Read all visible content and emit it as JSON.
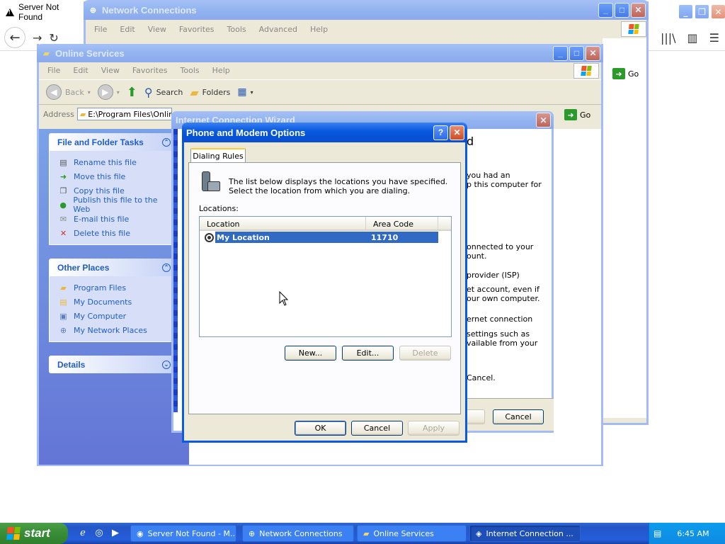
{
  "browser": {
    "tab_title": "Server Not Found",
    "back_glyph": "←",
    "forward_glyph": "→",
    "reload_glyph": "↻",
    "library_glyph": "|||\\",
    "sidebar_glyph": "▥",
    "menu_glyph": "☰",
    "min_glyph": "_",
    "restore_glyph": "❐",
    "close_glyph": "✕"
  },
  "net_window": {
    "title": "Network Connections",
    "menus": [
      "File",
      "Edit",
      "View",
      "Favorites",
      "Tools",
      "Advanced",
      "Help"
    ],
    "go_label": "Go"
  },
  "os_window": {
    "title": "Online Services",
    "menus": [
      "File",
      "Edit",
      "View",
      "Favorites",
      "Tools",
      "Help"
    ],
    "toolbar": {
      "back": "Back",
      "search": "Search",
      "folders": "Folders"
    },
    "address_label": "Address",
    "address_value": "E:\\Program Files\\Online Services",
    "go_label": "Go",
    "file_tasks": {
      "heading": "File and Folder Tasks",
      "items": [
        "Rename this file",
        "Move this file",
        "Copy this file",
        "Publish this file to the Web",
        "E-mail this file",
        "Delete this file"
      ]
    },
    "other_places": {
      "heading": "Other Places",
      "items": [
        "Program Files",
        "My Documents",
        "My Computer",
        "My Network Places"
      ]
    },
    "details": {
      "heading": "Details"
    }
  },
  "wizard": {
    "title": "Internet Connection Wizard",
    "heading_fragment": "d",
    "lines": [
      "you had an",
      "p this computer for",
      "onnected to your",
      "ount.",
      "provider (ISP)",
      "et account, even if",
      "our own computer.",
      "ernet connection",
      "settings such as",
      "vailable from your",
      "Cancel."
    ],
    "cancel_label": "Cancel"
  },
  "phone_dialog": {
    "title": "Phone and Modem Options",
    "help_glyph": "?",
    "close_glyph": "✕",
    "tab_label": "Dialing Rules",
    "description": "The list below displays the locations you have specified. Select the location from which you are dialing.",
    "locations_label": "Locations:",
    "columns": [
      "Location",
      "Area Code"
    ],
    "rows": [
      {
        "location": "My Location",
        "area_code": "11710"
      }
    ],
    "buttons": {
      "new": "New...",
      "edit": "Edit...",
      "delete": "Delete",
      "ok": "OK",
      "cancel": "Cancel",
      "apply": "Apply"
    }
  },
  "taskbar": {
    "start_label": "start",
    "tasks": [
      "Server Not Found - M...",
      "Network Connections",
      "Online Services",
      "Internet Connection ..."
    ],
    "clock": "6:45 AM"
  },
  "colors": {
    "xp_blue": "#0a5be0",
    "task_link": "#215dc6",
    "selection": "#316ac5"
  }
}
